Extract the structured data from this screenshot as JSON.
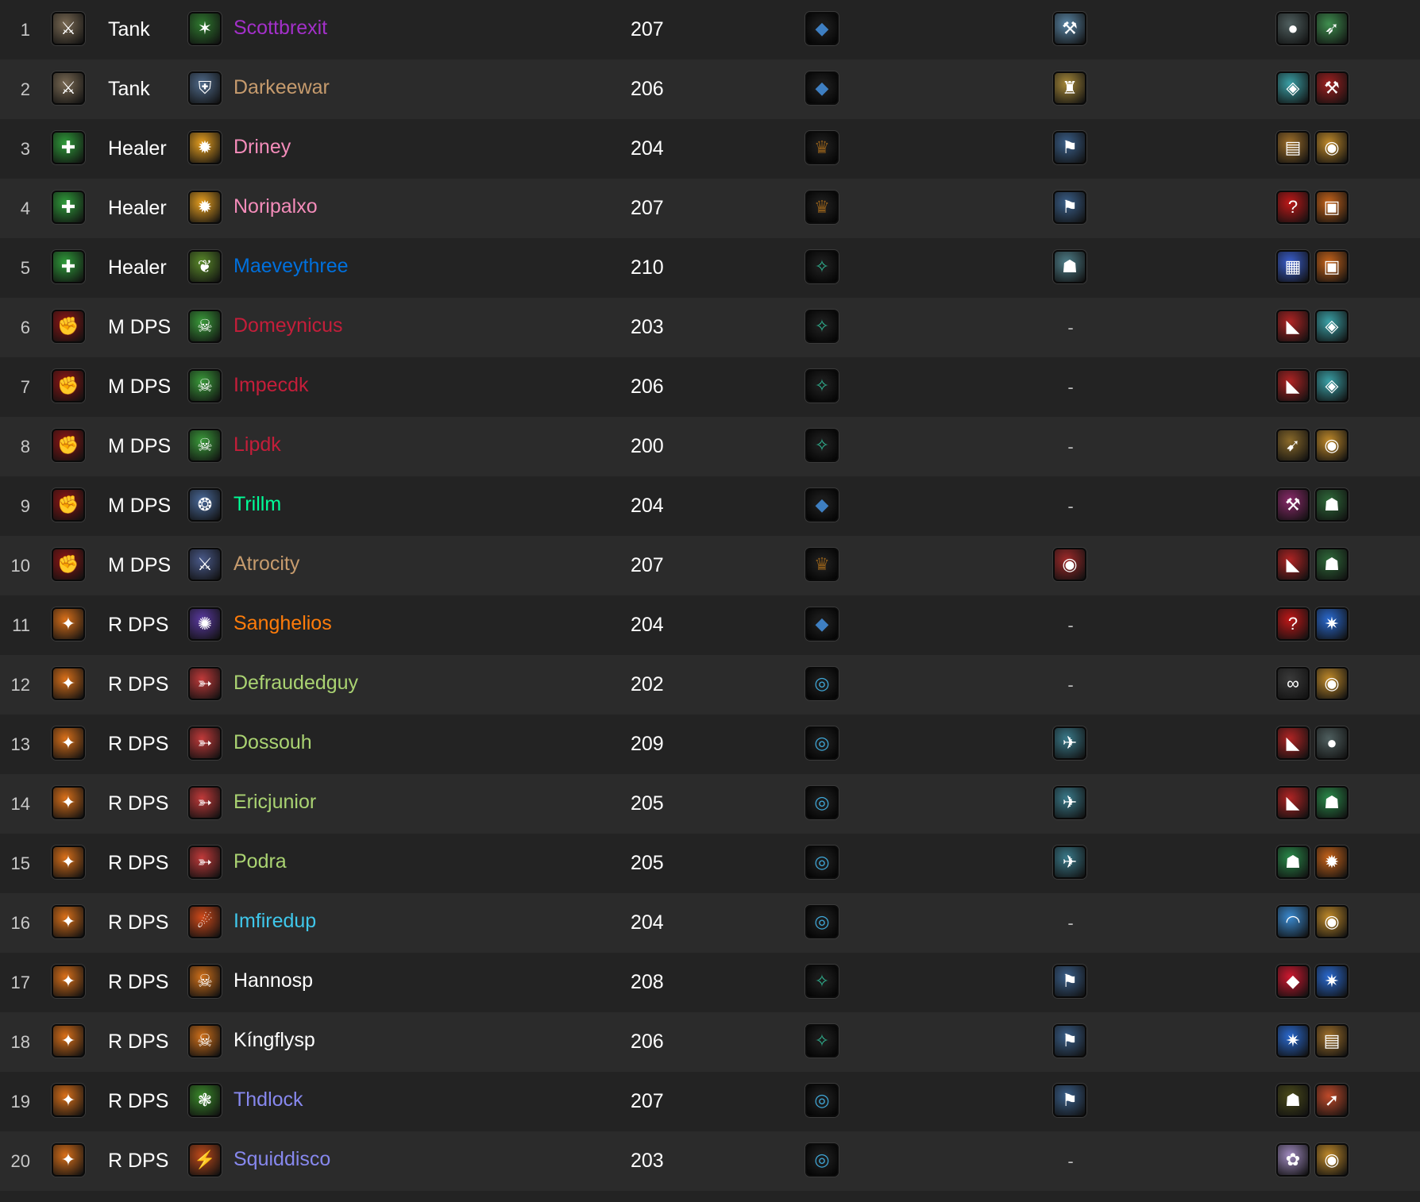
{
  "colors": {
    "background": "#232323",
    "row_alt": "#2b2b2b",
    "class_colors": {
      "warlock_purple": "#a330c9",
      "warrior": "#c69b6d",
      "paladin": "#f48cba",
      "shaman": "#0070dd",
      "death_knight": "#c41e3a",
      "monk": "#00ff98",
      "druid": "#ff7c0a",
      "hunter": "#aad372",
      "mage": "#3fc7eb",
      "priest": "#ffffff",
      "warlock": "#8788ee"
    }
  },
  "roles": {
    "tank": {
      "label": "Tank",
      "icon": "tank-role-icon",
      "color": "#7a6a54",
      "glyph": "⚔"
    },
    "healer": {
      "label": "Healer",
      "icon": "healer-role-icon",
      "color": "#2f9b3a",
      "glyph": "✚"
    },
    "mdps": {
      "label": "M DPS",
      "icon": "melee-dps-role-icon",
      "color": "#8e1616",
      "glyph": "✊"
    },
    "rdps": {
      "label": "R DPS",
      "icon": "ranged-dps-role-icon",
      "color": "#d9701a",
      "glyph": "✦"
    }
  },
  "covenants": {
    "kyrian": {
      "icon": "kyrian-covenant-icon",
      "color": "#3e7fc2",
      "glyph": "◆"
    },
    "venthyr": {
      "icon": "venthyr-covenant-icon",
      "color": "#8a5a1a",
      "glyph": "♛"
    },
    "necrolord": {
      "icon": "necrolord-covenant-icon",
      "color": "#2fae8d",
      "glyph": "✧"
    },
    "nightfae": {
      "icon": "night-fae-covenant-icon",
      "color": "#3fa6d6",
      "glyph": "◎"
    }
  },
  "rows": [
    {
      "rank": "1",
      "role": "tank",
      "spec_icon": "vengeance-spec-icon",
      "spec_color": "#2f7a2f",
      "spec_glyph": "✶",
      "name": "Scottbrexit",
      "name_color": "#a330c9",
      "ilvl": "207",
      "covenant": "kyrian",
      "legendary": {
        "icon": "legendary-icon",
        "color": "#5a86a6",
        "glyph": "⚒"
      },
      "trinkets": [
        {
          "icon": "trinket-icon",
          "color": "#4f5f5f",
          "glyph": "●"
        },
        {
          "icon": "trinket-icon",
          "color": "#3f8f4f",
          "glyph": "➶"
        }
      ]
    },
    {
      "rank": "2",
      "role": "tank",
      "spec_icon": "protection-warrior-spec-icon",
      "spec_color": "#4f6a8a",
      "spec_glyph": "⛨",
      "name": "Darkeewar",
      "name_color": "#c69b6d",
      "ilvl": "206",
      "covenant": "kyrian",
      "legendary": {
        "icon": "legendary-icon",
        "color": "#a88a3a",
        "glyph": "♜"
      },
      "trinkets": [
        {
          "icon": "trinket-icon",
          "color": "#3aa0a6",
          "glyph": "◈"
        },
        {
          "icon": "trinket-icon",
          "color": "#a02020",
          "glyph": "⚒"
        }
      ]
    },
    {
      "rank": "3",
      "role": "healer",
      "spec_icon": "holy-paladin-spec-icon",
      "spec_color": "#e8a020",
      "spec_glyph": "✹",
      "name": "Driney",
      "name_color": "#f48cba",
      "ilvl": "204",
      "covenant": "venthyr",
      "legendary": {
        "icon": "legendary-icon",
        "color": "#3a5f8a",
        "glyph": "⚑"
      },
      "trinkets": [
        {
          "icon": "trinket-icon",
          "color": "#a0702a",
          "glyph": "▤"
        },
        {
          "icon": "trinket-icon",
          "color": "#c08a2a",
          "glyph": "◉"
        }
      ]
    },
    {
      "rank": "4",
      "role": "healer",
      "spec_icon": "holy-paladin-spec-icon",
      "spec_color": "#e8a020",
      "spec_glyph": "✹",
      "name": "Noripalxo",
      "name_color": "#f48cba",
      "ilvl": "207",
      "covenant": "venthyr",
      "legendary": {
        "icon": "legendary-icon",
        "color": "#3a5f8a",
        "glyph": "⚑"
      },
      "trinkets": [
        {
          "icon": "trinket-icon",
          "color": "#c01818",
          "glyph": "?"
        },
        {
          "icon": "trinket-icon",
          "color": "#c8641a",
          "glyph": "▣"
        }
      ]
    },
    {
      "rank": "5",
      "role": "healer",
      "spec_icon": "restoration-shaman-spec-icon",
      "spec_color": "#5a8a2a",
      "spec_glyph": "❦",
      "name": "Maeveythree",
      "name_color": "#0070dd",
      "ilvl": "210",
      "covenant": "necrolord",
      "legendary": {
        "icon": "legendary-icon",
        "color": "#4f7f8a",
        "glyph": "☗"
      },
      "trinkets": [
        {
          "icon": "trinket-icon",
          "color": "#3a5fd0",
          "glyph": "▦"
        },
        {
          "icon": "trinket-icon",
          "color": "#c8641a",
          "glyph": "▣"
        }
      ]
    },
    {
      "rank": "6",
      "role": "mdps",
      "spec_icon": "unholy-spec-icon",
      "spec_color": "#3a9a3a",
      "spec_glyph": "☠",
      "name": "Domeynicus",
      "name_color": "#c41e3a",
      "ilvl": "203",
      "covenant": "necrolord",
      "legendary": null,
      "trinkets": [
        {
          "icon": "trinket-icon",
          "color": "#b02424",
          "glyph": "◣"
        },
        {
          "icon": "trinket-icon",
          "color": "#3aa0a6",
          "glyph": "◈"
        }
      ]
    },
    {
      "rank": "7",
      "role": "mdps",
      "spec_icon": "unholy-spec-icon",
      "spec_color": "#3a9a3a",
      "spec_glyph": "☠",
      "name": "Impecdk",
      "name_color": "#c41e3a",
      "ilvl": "206",
      "covenant": "necrolord",
      "legendary": null,
      "trinkets": [
        {
          "icon": "trinket-icon",
          "color": "#b02424",
          "glyph": "◣"
        },
        {
          "icon": "trinket-icon",
          "color": "#3aa0a6",
          "glyph": "◈"
        }
      ]
    },
    {
      "rank": "8",
      "role": "mdps",
      "spec_icon": "unholy-spec-icon",
      "spec_color": "#3a9a3a",
      "spec_glyph": "☠",
      "name": "Lipdk",
      "name_color": "#c41e3a",
      "ilvl": "200",
      "covenant": "necrolord",
      "legendary": null,
      "trinkets": [
        {
          "icon": "trinket-icon",
          "color": "#8a6a2a",
          "glyph": "➹"
        },
        {
          "icon": "trinket-icon",
          "color": "#c08a2a",
          "glyph": "◉"
        }
      ]
    },
    {
      "rank": "9",
      "role": "mdps",
      "spec_icon": "windwalker-spec-icon",
      "spec_color": "#4a6a9a",
      "spec_glyph": "❂",
      "name": "Trillm",
      "name_color": "#00ff98",
      "ilvl": "204",
      "covenant": "kyrian",
      "legendary": null,
      "trinkets": [
        {
          "icon": "trinket-icon",
          "color": "#8a2a6a",
          "glyph": "⚒"
        },
        {
          "icon": "trinket-icon",
          "color": "#2f6a3a",
          "glyph": "☗"
        }
      ]
    },
    {
      "rank": "10",
      "role": "mdps",
      "spec_icon": "arms-spec-icon",
      "spec_color": "#4a5a8a",
      "spec_glyph": "⚔",
      "name": "Atrocity",
      "name_color": "#c69b6d",
      "ilvl": "207",
      "covenant": "venthyr",
      "legendary": {
        "icon": "legendary-icon",
        "color": "#a02a2a",
        "glyph": "◉"
      },
      "trinkets": [
        {
          "icon": "trinket-icon",
          "color": "#b02424",
          "glyph": "◣"
        },
        {
          "icon": "trinket-icon",
          "color": "#2f6a3a",
          "glyph": "☗"
        }
      ]
    },
    {
      "rank": "11",
      "role": "rdps",
      "spec_icon": "balance-spec-icon",
      "spec_color": "#5a3aa0",
      "spec_glyph": "✺",
      "name": "Sanghelios",
      "name_color": "#ff7c0a",
      "ilvl": "204",
      "covenant": "kyrian",
      "legendary": null,
      "trinkets": [
        {
          "icon": "trinket-icon",
          "color": "#c01818",
          "glyph": "?"
        },
        {
          "icon": "trinket-icon",
          "color": "#2a6ad0",
          "glyph": "✷"
        }
      ]
    },
    {
      "rank": "12",
      "role": "rdps",
      "spec_icon": "marksmanship-spec-icon",
      "spec_color": "#c03a3a",
      "spec_glyph": "➳",
      "name": "Defraudedguy",
      "name_color": "#aad372",
      "ilvl": "202",
      "covenant": "nightfae",
      "legendary": null,
      "trinkets": [
        {
          "icon": "trinket-icon",
          "color": "#3a3a3a",
          "glyph": "∞"
        },
        {
          "icon": "trinket-icon",
          "color": "#c08a2a",
          "glyph": "◉"
        }
      ]
    },
    {
      "rank": "13",
      "role": "rdps",
      "spec_icon": "marksmanship-spec-icon",
      "spec_color": "#c03a3a",
      "spec_glyph": "➳",
      "name": "Dossouh",
      "name_color": "#aad372",
      "ilvl": "209",
      "covenant": "nightfae",
      "legendary": {
        "icon": "legendary-icon",
        "color": "#3a7a8a",
        "glyph": "✈"
      },
      "trinkets": [
        {
          "icon": "trinket-icon",
          "color": "#b02424",
          "glyph": "◣"
        },
        {
          "icon": "trinket-icon",
          "color": "#4f5f5f",
          "glyph": "●"
        }
      ]
    },
    {
      "rank": "14",
      "role": "rdps",
      "spec_icon": "marksmanship-spec-icon",
      "spec_color": "#c03a3a",
      "spec_glyph": "➳",
      "name": "Ericjunior",
      "name_color": "#aad372",
      "ilvl": "205",
      "covenant": "nightfae",
      "legendary": {
        "icon": "legendary-icon",
        "color": "#3a7a8a",
        "glyph": "✈"
      },
      "trinkets": [
        {
          "icon": "trinket-icon",
          "color": "#b02424",
          "glyph": "◣"
        },
        {
          "icon": "trinket-icon",
          "color": "#2a8a4a",
          "glyph": "☗"
        }
      ]
    },
    {
      "rank": "15",
      "role": "rdps",
      "spec_icon": "marksmanship-spec-icon",
      "spec_color": "#c03a3a",
      "spec_glyph": "➳",
      "name": "Podra",
      "name_color": "#aad372",
      "ilvl": "205",
      "covenant": "nightfae",
      "legendary": {
        "icon": "legendary-icon",
        "color": "#3a7a8a",
        "glyph": "✈"
      },
      "trinkets": [
        {
          "icon": "trinket-icon",
          "color": "#2a8a4a",
          "glyph": "☗"
        },
        {
          "icon": "trinket-icon",
          "color": "#c8641a",
          "glyph": "✹"
        }
      ]
    },
    {
      "rank": "16",
      "role": "rdps",
      "spec_icon": "fire-mage-spec-icon",
      "spec_color": "#d04a1a",
      "spec_glyph": "☄",
      "name": "Imfiredup",
      "name_color": "#3fc7eb",
      "ilvl": "204",
      "covenant": "nightfae",
      "legendary": null,
      "trinkets": [
        {
          "icon": "trinket-icon",
          "color": "#3a8ad0",
          "glyph": "◠"
        },
        {
          "icon": "trinket-icon",
          "color": "#c08a2a",
          "glyph": "◉"
        }
      ]
    },
    {
      "rank": "17",
      "role": "rdps",
      "spec_icon": "shadow-priest-spec-icon",
      "spec_color": "#d0701a",
      "spec_glyph": "☠",
      "name": "Hannosp",
      "name_color": "#ffffff",
      "ilvl": "208",
      "covenant": "necrolord",
      "legendary": {
        "icon": "legendary-icon",
        "color": "#3a5f8a",
        "glyph": "⚑"
      },
      "trinkets": [
        {
          "icon": "trinket-icon",
          "color": "#d01830",
          "glyph": "◆"
        },
        {
          "icon": "trinket-icon",
          "color": "#2a6ad0",
          "glyph": "✷"
        }
      ]
    },
    {
      "rank": "18",
      "role": "rdps",
      "spec_icon": "shadow-priest-spec-icon",
      "spec_color": "#d0701a",
      "spec_glyph": "☠",
      "name": "Kíngflysp",
      "name_color": "#ffffff",
      "ilvl": "206",
      "covenant": "necrolord",
      "legendary": {
        "icon": "legendary-icon",
        "color": "#3a5f8a",
        "glyph": "⚑"
      },
      "trinkets": [
        {
          "icon": "trinket-icon",
          "color": "#2a6ad0",
          "glyph": "✷"
        },
        {
          "icon": "trinket-icon",
          "color": "#a0702a",
          "glyph": "▤"
        }
      ]
    },
    {
      "rank": "19",
      "role": "rdps",
      "spec_icon": "affliction-spec-icon",
      "spec_color": "#3a8a2a",
      "spec_glyph": "❃",
      "name": "Thdlock",
      "name_color": "#8788ee",
      "ilvl": "207",
      "covenant": "nightfae",
      "legendary": {
        "icon": "legendary-icon",
        "color": "#3a5f8a",
        "glyph": "⚑"
      },
      "trinkets": [
        {
          "icon": "trinket-icon",
          "color": "#4a4a1a",
          "glyph": "☗"
        },
        {
          "icon": "trinket-icon",
          "color": "#c04a2a",
          "glyph": "➚"
        }
      ]
    },
    {
      "rank": "20",
      "role": "rdps",
      "spec_icon": "destruction-spec-icon",
      "spec_color": "#c04a1a",
      "spec_glyph": "⚡",
      "name": "Squiddisco",
      "name_color": "#8788ee",
      "ilvl": "203",
      "covenant": "nightfae",
      "legendary": null,
      "trinkets": [
        {
          "icon": "trinket-icon",
          "color": "#a08ac0",
          "glyph": "✿"
        },
        {
          "icon": "trinket-icon",
          "color": "#c08a2a",
          "glyph": "◉"
        }
      ]
    }
  ],
  "empty_legendary_text": "-"
}
